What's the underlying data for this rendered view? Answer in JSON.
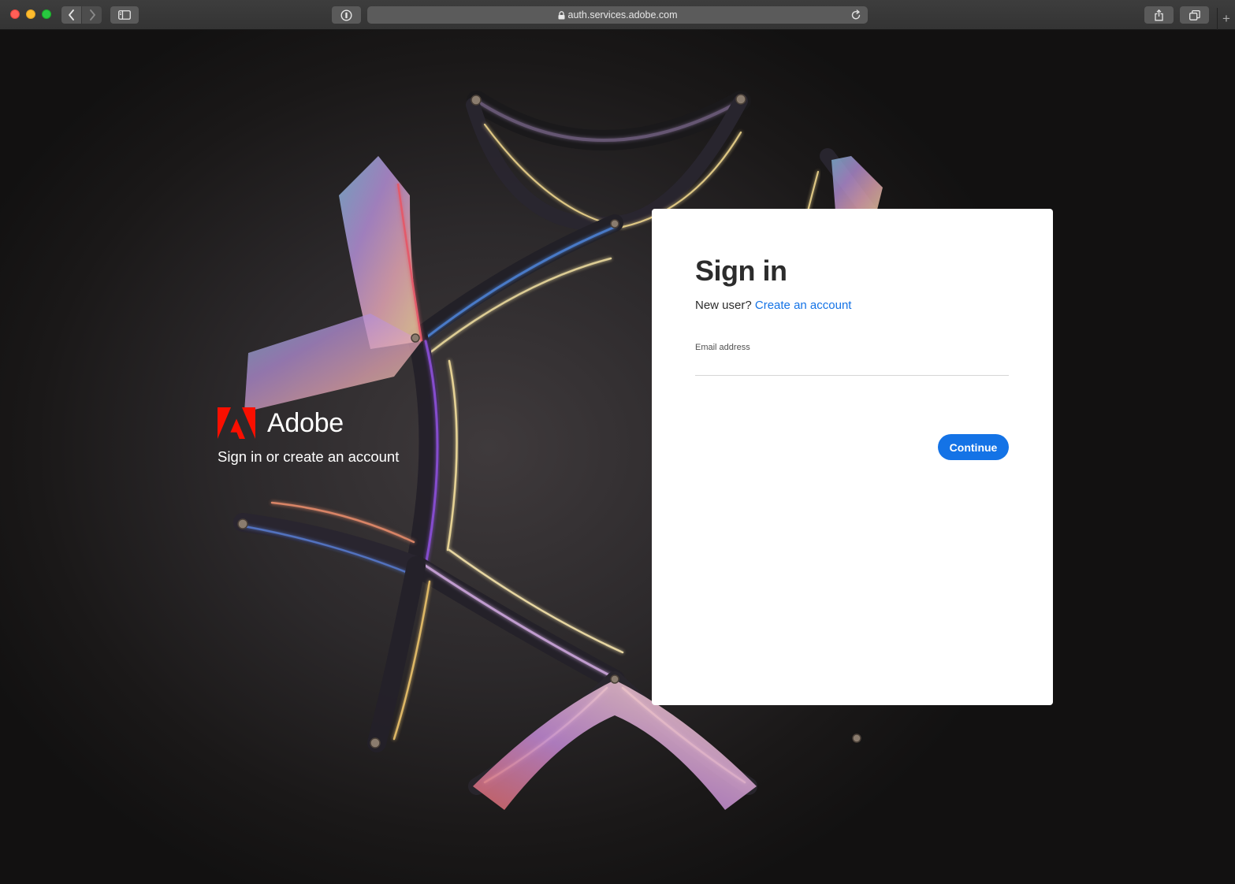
{
  "browser": {
    "url": "auth.services.adobe.com",
    "icons": [
      "back-icon",
      "forward-icon",
      "sidebar-icon",
      "password-icon",
      "lock-icon",
      "reload-icon",
      "share-icon",
      "tabs-icon",
      "plus-icon"
    ]
  },
  "brand": {
    "name": "Adobe",
    "tagline": "Sign in or create an account"
  },
  "signin": {
    "title": "Sign in",
    "new_user_prompt": "New user?",
    "create_account_link": "Create an account",
    "email_label": "Email address",
    "email_value": "",
    "continue_label": "Continue"
  },
  "colors": {
    "accent": "#1473e6",
    "adobe_red": "#fa0f00"
  }
}
